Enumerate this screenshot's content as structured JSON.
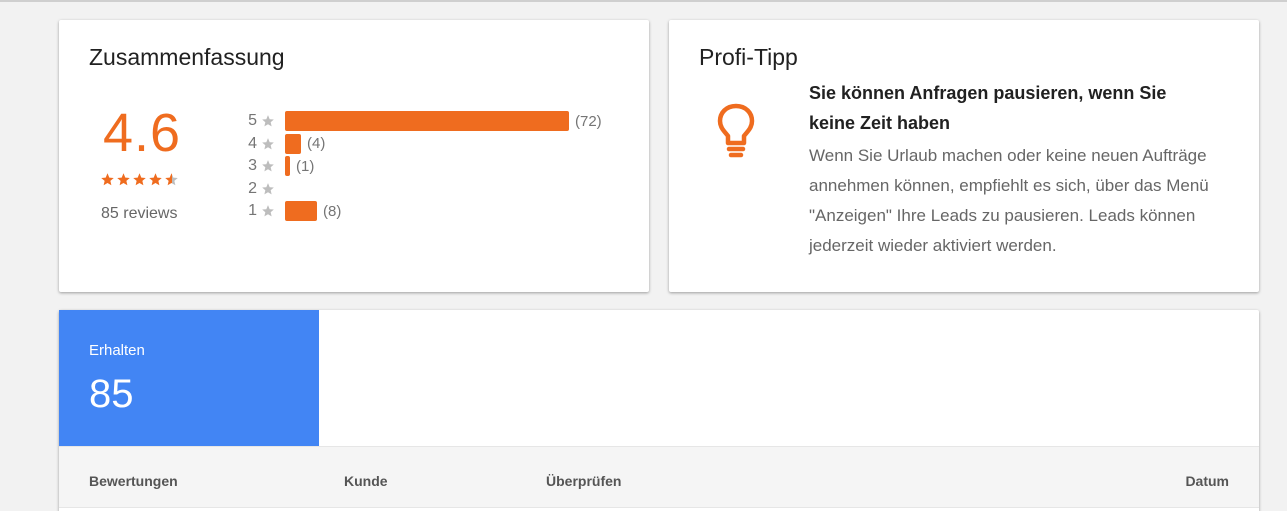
{
  "summary": {
    "title": "Zusammenfassung",
    "average": "4.6",
    "stars_value": 4.6,
    "reviews_label": "85 reviews",
    "distribution": [
      {
        "level": "5",
        "count_label": "(72)",
        "count": 72
      },
      {
        "level": "4",
        "count_label": "(4)",
        "count": 4
      },
      {
        "level": "3",
        "count_label": "(1)",
        "count": 1
      },
      {
        "level": "2",
        "count_label": "",
        "count": 0
      },
      {
        "level": "1",
        "count_label": "(8)",
        "count": 8
      }
    ]
  },
  "tip": {
    "title": "Profi-Tipp",
    "icon": "lightbulb-icon",
    "headline": "Sie können Anfragen pausieren, wenn Sie keine Zeit haben",
    "body": "Wenn Sie Urlaub machen oder keine neuen Aufträge annehmen können, empfiehlt es sich, über das Menü \"Anzeigen\" Ihre Leads zu pausieren. Leads können jederzeit wieder aktiviert werden."
  },
  "received": {
    "label": "Erhalten",
    "value": "85"
  },
  "table": {
    "headers": [
      "Bewertungen",
      "Kunde",
      "Überprüfen",
      "Datum"
    ]
  },
  "colors": {
    "accent": "#ef6c1f",
    "blue": "#4285f4",
    "star_grey": "#bdbdbd"
  }
}
